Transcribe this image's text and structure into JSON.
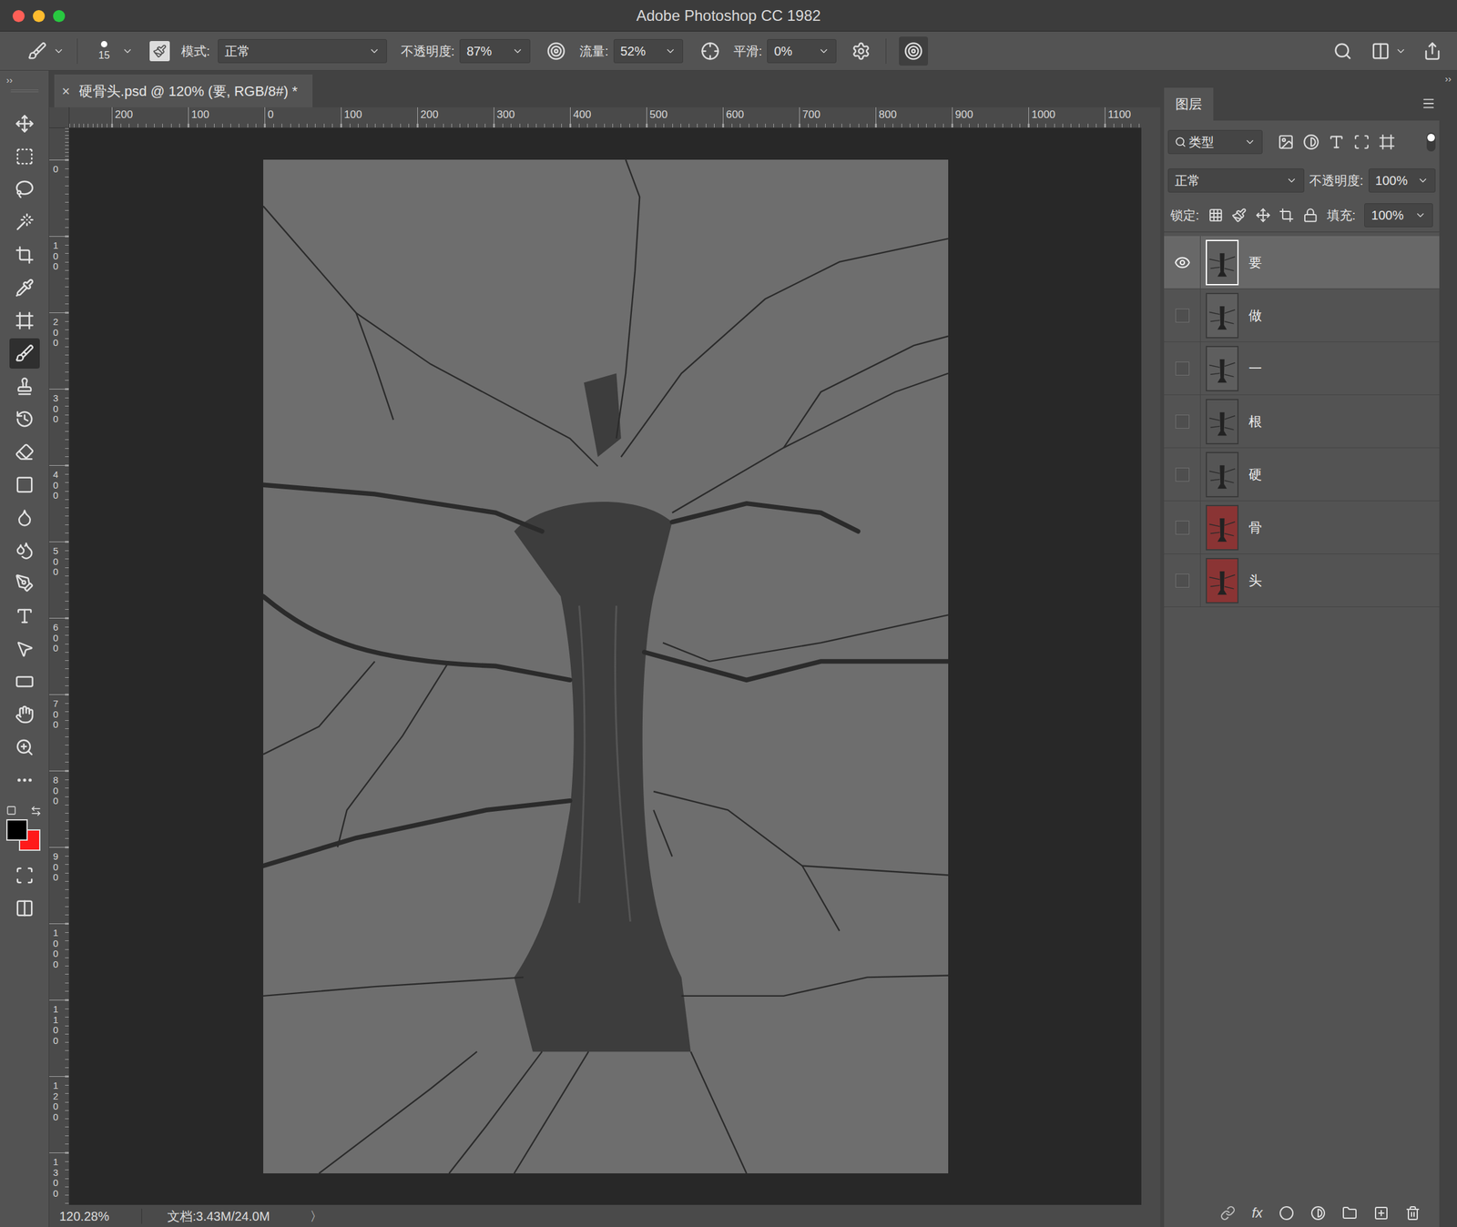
{
  "window": {
    "title": "Adobe Photoshop CC 1982"
  },
  "options_bar": {
    "brush_size": "15",
    "mode_label": "模式:",
    "mode": "正常",
    "opacity_label": "不透明度:",
    "opacity": "87%",
    "flow_label": "流量:",
    "flow": "52%",
    "smoothing_label": "平滑:",
    "smoothing": "0%"
  },
  "toolbar": {
    "collapse": "››",
    "tools": [
      {
        "kind": "move",
        "selected": false
      },
      {
        "kind": "marquee",
        "selected": false
      },
      {
        "kind": "lasso",
        "selected": false
      },
      {
        "kind": "wand",
        "selected": false
      },
      {
        "kind": "crop",
        "selected": false
      },
      {
        "kind": "eyedropper",
        "selected": false
      },
      {
        "kind": "frame",
        "selected": false
      },
      {
        "kind": "brush",
        "selected": true
      },
      {
        "kind": "stamp",
        "selected": false
      },
      {
        "kind": "history",
        "selected": false
      },
      {
        "kind": "eraser",
        "selected": false
      },
      {
        "kind": "gradient",
        "selected": false
      },
      {
        "kind": "blur",
        "selected": false
      },
      {
        "kind": "dodge",
        "selected": false
      },
      {
        "kind": "pen",
        "selected": false
      },
      {
        "kind": "type",
        "selected": false
      },
      {
        "kind": "select",
        "selected": false
      },
      {
        "kind": "shape",
        "selected": false
      },
      {
        "kind": "hand",
        "selected": false
      },
      {
        "kind": "zoom",
        "selected": false
      },
      {
        "kind": "more",
        "selected": false
      }
    ],
    "colors": [
      {
        "name": "foreground",
        "color": "#000000"
      },
      {
        "name": "background",
        "color": "#ff1a1a"
      }
    ]
  },
  "document_tab": {
    "title": "硬骨头.psd @ 120% (要, RGB/8#) *",
    "close": "×"
  },
  "rulers": {
    "top": [
      "200",
      "100",
      "0",
      "100",
      "200",
      "300",
      "400",
      "500",
      "600",
      "700",
      "800",
      "900",
      "1000",
      "1100"
    ],
    "left": [
      "0",
      "100",
      "200",
      "300",
      "400",
      "500",
      "600",
      "700",
      "800",
      "900",
      "1000",
      "1100",
      "1200",
      "1300"
    ]
  },
  "status_bar": {
    "zoom": "120.28%",
    "document": "文档:3.43M/24.0M",
    "arrow": "〉"
  },
  "layers_panel": {
    "collapse": "››",
    "tab": "图层",
    "filter": "类型",
    "blend_mode": "正常",
    "opacity_label": "不透明度:",
    "opacity": "100%",
    "lock_label": "锁定:",
    "fill_label": "填充:",
    "fill": "100%",
    "fx": "fx",
    "layers": [
      {
        "name": "要",
        "visible": true,
        "selected": true,
        "color": "#5e5e5e"
      },
      {
        "name": "做",
        "visible": false,
        "selected": false,
        "color": "#5e5e5e"
      },
      {
        "name": "一",
        "visible": false,
        "selected": false,
        "color": "#5e5e5e"
      },
      {
        "name": "根",
        "visible": false,
        "selected": false,
        "color": "#555555"
      },
      {
        "name": "硬",
        "visible": false,
        "selected": false,
        "color": "#555555"
      },
      {
        "name": "骨",
        "visible": false,
        "selected": false,
        "color": "#8a3434"
      },
      {
        "name": "头",
        "visible": false,
        "selected": false,
        "color": "#8a3434"
      }
    ]
  }
}
